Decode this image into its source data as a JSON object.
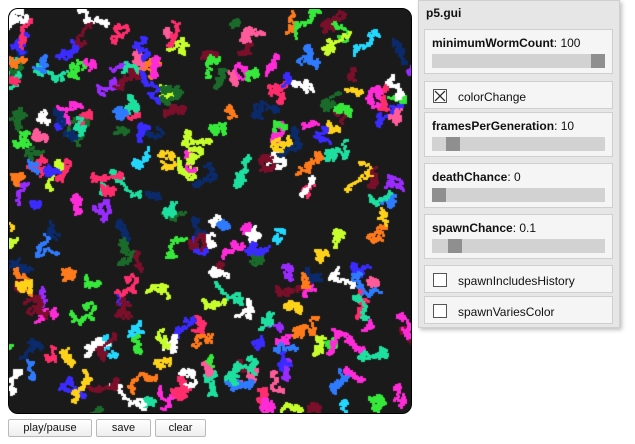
{
  "gui": {
    "title": "p5.gui",
    "controls": [
      {
        "label": "minimumWormCount",
        "value": "100",
        "level": 1.0
      },
      {
        "label": "colorChange",
        "checked": true
      },
      {
        "label": "framesPerGeneration",
        "value": "10",
        "level": 0.09
      },
      {
        "label": "deathChance",
        "value": "0",
        "level": 0.0
      },
      {
        "label": "spawnChance",
        "value": "0.1",
        "level": 0.1
      },
      {
        "label": "spawnIncludesHistory",
        "checked": false
      },
      {
        "label": "spawnVariesColor",
        "checked": false
      }
    ]
  },
  "buttons": {
    "play_pause": "play/pause",
    "save": "save",
    "clear": "clear"
  },
  "canvas": {
    "palette": [
      "#ff2d6b",
      "#ff7a1a",
      "#ffd21a",
      "#c7ff2a",
      "#35e83a",
      "#1de0a0",
      "#22d8ff",
      "#2f7bff",
      "#3a2bff",
      "#9a2bff",
      "#ff2bd8",
      "#ff5a9a",
      "#7a0f2a",
      "#1a6b2a",
      "#0a2a6b",
      "#ffffff"
    ]
  }
}
